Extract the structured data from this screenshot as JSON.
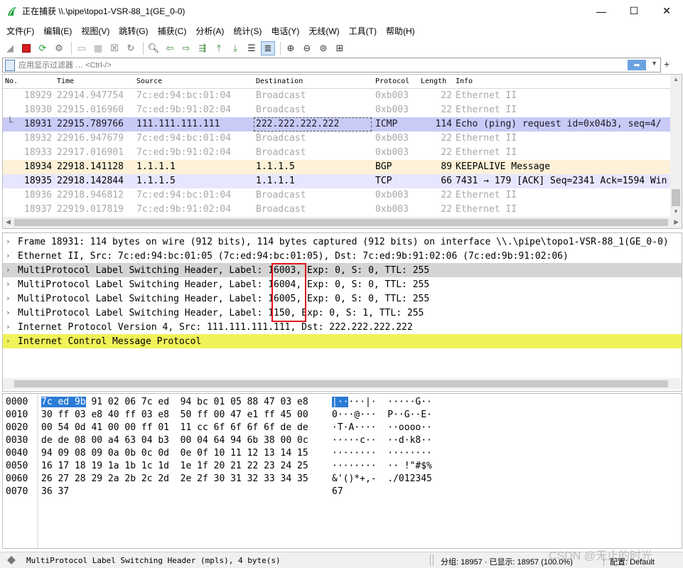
{
  "window": {
    "title": "正在捕获 \\\\.\\pipe\\topo1-VSR-88_1(GE_0-0)",
    "controls": [
      "—",
      "☐",
      "✕"
    ]
  },
  "menu": [
    "文件(F)",
    "编辑(E)",
    "视图(V)",
    "跳转(G)",
    "捕获(C)",
    "分析(A)",
    "统计(S)",
    "电话(Y)",
    "无线(W)",
    "工具(T)",
    "帮助(H)"
  ],
  "filter": {
    "placeholder": "应用显示过滤器 … <Ctrl-/>",
    "apply_icon": "arrow-right-icon"
  },
  "packet_list": {
    "columns": [
      "No.",
      "Time",
      "Source",
      "Destination",
      "Protocol",
      "Length",
      "Info"
    ],
    "rows": [
      {
        "no": "18929",
        "time": "22914.947754",
        "src": "7c:ed:94:bc:01:04",
        "dst": "Broadcast",
        "proto": "0xb003",
        "len": "22",
        "info": "Ethernet II",
        "style": "gray"
      },
      {
        "no": "18930",
        "time": "22915.016960",
        "src": "7c:ed:9b:91:02:04",
        "dst": "Broadcast",
        "proto": "0xb003",
        "len": "22",
        "info": "Ethernet II",
        "style": "gray"
      },
      {
        "no": "18931",
        "time": "22915.789766",
        "src": "111.111.111.111",
        "dst": "222.222.222.222",
        "proto": "ICMP",
        "len": "114",
        "info": "Echo (ping) request  id=0x04b3, seq=4/",
        "style": "sel"
      },
      {
        "no": "18932",
        "time": "22916.947679",
        "src": "7c:ed:94:bc:01:04",
        "dst": "Broadcast",
        "proto": "0xb003",
        "len": "22",
        "info": "Ethernet II",
        "style": "gray"
      },
      {
        "no": "18933",
        "time": "22917.016901",
        "src": "7c:ed:9b:91:02:04",
        "dst": "Broadcast",
        "proto": "0xb003",
        "len": "22",
        "info": "Ethernet II",
        "style": "gray"
      },
      {
        "no": "18934",
        "time": "22918.141128",
        "src": "1.1.1.1",
        "dst": "1.1.1.5",
        "proto": "BGP",
        "len": "89",
        "info": "KEEPALIVE Message",
        "style": "bgp"
      },
      {
        "no": "18935",
        "time": "22918.142844",
        "src": "1.1.1.5",
        "dst": "1.1.1.1",
        "proto": "TCP",
        "len": "66",
        "info": "7431 → 179 [ACK] Seq=2341 Ack=1594 Win",
        "style": "tcp"
      },
      {
        "no": "18936",
        "time": "22918.946812",
        "src": "7c:ed:94:bc:01:04",
        "dst": "Broadcast",
        "proto": "0xb003",
        "len": "22",
        "info": "Ethernet II",
        "style": "gray"
      },
      {
        "no": "18937",
        "time": "22919.017819",
        "src": "7c:ed:9b:91:02:04",
        "dst": "Broadcast",
        "proto": "0xb003",
        "len": "22",
        "info": "Ethernet II",
        "style": "gray"
      }
    ]
  },
  "details": [
    {
      "text": "Frame 18931: 114 bytes on wire (912 bits), 114 bytes captured (912 bits) on interface \\\\.\\pipe\\topo1-VSR-88_1(GE_0-0)",
      "style": ""
    },
    {
      "text": "Ethernet II, Src: 7c:ed:94:bc:01:05 (7c:ed:94:bc:01:05), Dst: 7c:ed:9b:91:02:06 (7c:ed:9b:91:02:06)",
      "style": ""
    },
    {
      "text": "MultiProtocol Label Switching Header, Label: 16003, Exp: 0, S: 0, TTL: 255",
      "style": "hl"
    },
    {
      "text": "MultiProtocol Label Switching Header, Label: 16004, Exp: 0, S: 0, TTL: 255",
      "style": ""
    },
    {
      "text": "MultiProtocol Label Switching Header, Label: 16005, Exp: 0, S: 0, TTL: 255",
      "style": ""
    },
    {
      "text": "MultiProtocol Label Switching Header, Label: 1150, Exp: 0, S: 1, TTL: 255",
      "style": ""
    },
    {
      "text": "Internet Protocol Version 4, Src: 111.111.111.111, Dst: 222.222.222.222",
      "style": ""
    },
    {
      "text": "Internet Control Message Protocol",
      "style": "yel"
    }
  ],
  "bytes": [
    {
      "off": "0000",
      "hex_sel": "7c ed 9b",
      "hex_rest": " 91 02 06 7c ed  94 bc 01 05 88 47 03 e8",
      "ascii_sel": "|··",
      "ascii_rest": "···|·  ·····G··"
    },
    {
      "off": "0010",
      "hex_sel": "",
      "hex_rest": "30 ff 03 e8 40 ff 03 e8  50 ff 00 47 e1 ff 45 00",
      "ascii_sel": "",
      "ascii_rest": "0···@···  P··G··E·"
    },
    {
      "off": "0020",
      "hex_sel": "",
      "hex_rest": "00 54 0d 41 00 00 ff 01  11 cc 6f 6f 6f 6f de de",
      "ascii_sel": "",
      "ascii_rest": "·T·A····  ··oooo··"
    },
    {
      "off": "0030",
      "hex_sel": "",
      "hex_rest": "de de 08 00 a4 63 04 b3  00 04 64 94 6b 38 00 0c",
      "ascii_sel": "",
      "ascii_rest": "·····c··  ··d·k8··"
    },
    {
      "off": "0040",
      "hex_sel": "",
      "hex_rest": "94 09 08 09 0a 0b 0c 0d  0e 0f 10 11 12 13 14 15",
      "ascii_sel": "",
      "ascii_rest": "········  ········"
    },
    {
      "off": "0050",
      "hex_sel": "",
      "hex_rest": "16 17 18 19 1a 1b 1c 1d  1e 1f 20 21 22 23 24 25",
      "ascii_sel": "",
      "ascii_rest": "········  ·· !\"#$%"
    },
    {
      "off": "0060",
      "hex_sel": "",
      "hex_rest": "26 27 28 29 2a 2b 2c 2d  2e 2f 30 31 32 33 34 35",
      "ascii_sel": "",
      "ascii_rest": "&'()*+,-  ./012345"
    },
    {
      "off": "0070",
      "hex_sel": "",
      "hex_rest": "36 37",
      "ascii_sel": "",
      "ascii_rest": "67"
    }
  ],
  "status": {
    "field_info": "MultiProtocol Label Switching Header (mpls), 4 byte(s)",
    "packets": "分组: 18957 · 已显示: 18957 (100.0%)",
    "profile": "配置: Default"
  },
  "watermark": "CSDN @无止的时光",
  "colors": {
    "selected_row": "#c9caf5",
    "bgp_row": "#fdf2d9",
    "tcp_row": "#e7e6ff",
    "highlight_detail": "#d4d4d4",
    "icmp_detail": "#f0f25a",
    "annotation_box": "#e0161e",
    "byte_selection": "#2b7bd6"
  }
}
